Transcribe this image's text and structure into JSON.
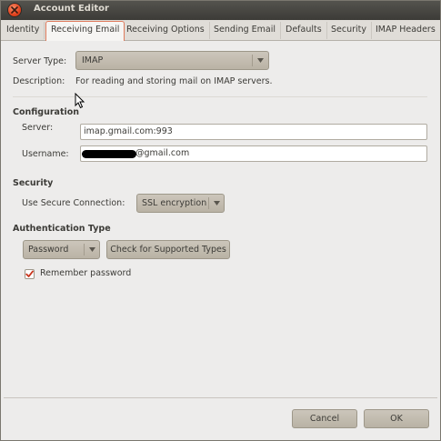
{
  "window": {
    "title": "Account Editor"
  },
  "tabs": [
    {
      "label": "Identity"
    },
    {
      "label": "Receiving Email"
    },
    {
      "label": "Receiving Options"
    },
    {
      "label": "Sending Email"
    },
    {
      "label": "Defaults"
    },
    {
      "label": "Security"
    },
    {
      "label": "IMAP Headers"
    }
  ],
  "active_tab_color": "#df7b5d",
  "server_type": {
    "label": "Server Type:",
    "value": "IMAP"
  },
  "description": {
    "label": "Description:",
    "value": "For reading and storing mail on IMAP servers."
  },
  "configuration": {
    "heading": "Configuration",
    "server_label": "Server:",
    "server_value": "imap.gmail.com:993",
    "username_label": "Username:",
    "username_visible_suffix": "@gmail.com"
  },
  "security": {
    "heading": "Security",
    "secure_label": "Use Secure Connection:",
    "secure_value": "SSL encryption"
  },
  "auth": {
    "heading": "Authentication Type",
    "type_value": "Password",
    "check_button": "Check for Supported Types",
    "remember_label": "Remember password",
    "remember_checked": true
  },
  "footer": {
    "cancel": "Cancel",
    "ok": "OK"
  }
}
